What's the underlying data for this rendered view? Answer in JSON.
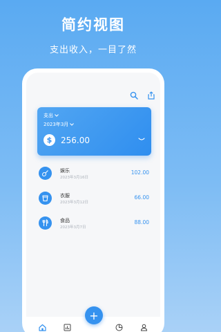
{
  "promo": {
    "title": "简约视图",
    "subtitle": "支出收入，一目了然"
  },
  "card": {
    "type_label": "支出",
    "month_label": "2023年3月",
    "amount": "256.00",
    "currency_icon": "$",
    "gradient_start": "#52a6f2",
    "gradient_end": "#2f8eef"
  },
  "records": [
    {
      "name": "娱乐",
      "date": "2023年3月16日",
      "amount": "102.00",
      "icon": "guitar-icon"
    },
    {
      "name": "衣服",
      "date": "2023年3月12日",
      "amount": "66.00",
      "icon": "cup-icon"
    },
    {
      "name": "食品",
      "date": "2023年3月7日",
      "amount": "88.00",
      "icon": "utensils-icon"
    }
  ],
  "fab": {
    "label": "+"
  },
  "colors": {
    "accent": "#3592ef",
    "background_top": "#5aaaf2",
    "background_bottom": "#a9d1f7"
  },
  "nav": {
    "items": [
      "home-icon",
      "stats-icon",
      "chart-icon",
      "profile-icon"
    ],
    "active": "home-icon"
  }
}
